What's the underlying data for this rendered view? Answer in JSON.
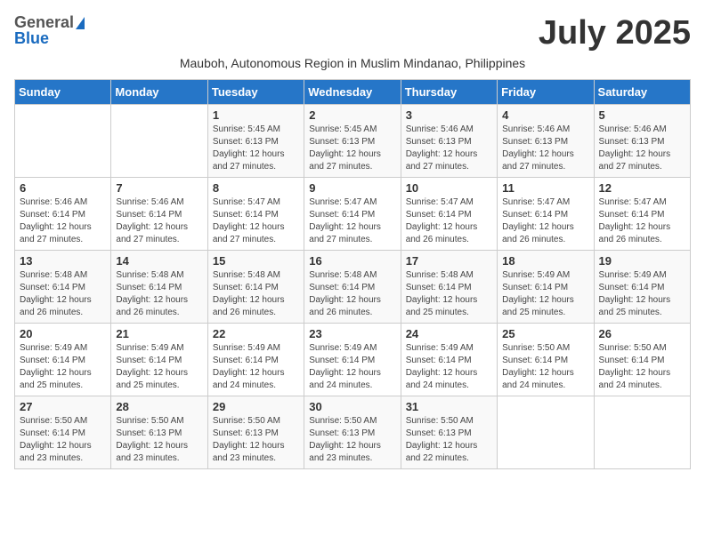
{
  "logo": {
    "general": "General",
    "blue": "Blue"
  },
  "title": "July 2025",
  "subtitle": "Mauboh, Autonomous Region in Muslim Mindanao, Philippines",
  "days_of_week": [
    "Sunday",
    "Monday",
    "Tuesday",
    "Wednesday",
    "Thursday",
    "Friday",
    "Saturday"
  ],
  "weeks": [
    [
      {
        "day": "",
        "sunrise": "",
        "sunset": "",
        "daylight": ""
      },
      {
        "day": "",
        "sunrise": "",
        "sunset": "",
        "daylight": ""
      },
      {
        "day": "1",
        "sunrise": "Sunrise: 5:45 AM",
        "sunset": "Sunset: 6:13 PM",
        "daylight": "Daylight: 12 hours and 27 minutes."
      },
      {
        "day": "2",
        "sunrise": "Sunrise: 5:45 AM",
        "sunset": "Sunset: 6:13 PM",
        "daylight": "Daylight: 12 hours and 27 minutes."
      },
      {
        "day": "3",
        "sunrise": "Sunrise: 5:46 AM",
        "sunset": "Sunset: 6:13 PM",
        "daylight": "Daylight: 12 hours and 27 minutes."
      },
      {
        "day": "4",
        "sunrise": "Sunrise: 5:46 AM",
        "sunset": "Sunset: 6:13 PM",
        "daylight": "Daylight: 12 hours and 27 minutes."
      },
      {
        "day": "5",
        "sunrise": "Sunrise: 5:46 AM",
        "sunset": "Sunset: 6:13 PM",
        "daylight": "Daylight: 12 hours and 27 minutes."
      }
    ],
    [
      {
        "day": "6",
        "sunrise": "Sunrise: 5:46 AM",
        "sunset": "Sunset: 6:14 PM",
        "daylight": "Daylight: 12 hours and 27 minutes."
      },
      {
        "day": "7",
        "sunrise": "Sunrise: 5:46 AM",
        "sunset": "Sunset: 6:14 PM",
        "daylight": "Daylight: 12 hours and 27 minutes."
      },
      {
        "day": "8",
        "sunrise": "Sunrise: 5:47 AM",
        "sunset": "Sunset: 6:14 PM",
        "daylight": "Daylight: 12 hours and 27 minutes."
      },
      {
        "day": "9",
        "sunrise": "Sunrise: 5:47 AM",
        "sunset": "Sunset: 6:14 PM",
        "daylight": "Daylight: 12 hours and 27 minutes."
      },
      {
        "day": "10",
        "sunrise": "Sunrise: 5:47 AM",
        "sunset": "Sunset: 6:14 PM",
        "daylight": "Daylight: 12 hours and 26 minutes."
      },
      {
        "day": "11",
        "sunrise": "Sunrise: 5:47 AM",
        "sunset": "Sunset: 6:14 PM",
        "daylight": "Daylight: 12 hours and 26 minutes."
      },
      {
        "day": "12",
        "sunrise": "Sunrise: 5:47 AM",
        "sunset": "Sunset: 6:14 PM",
        "daylight": "Daylight: 12 hours and 26 minutes."
      }
    ],
    [
      {
        "day": "13",
        "sunrise": "Sunrise: 5:48 AM",
        "sunset": "Sunset: 6:14 PM",
        "daylight": "Daylight: 12 hours and 26 minutes."
      },
      {
        "day": "14",
        "sunrise": "Sunrise: 5:48 AM",
        "sunset": "Sunset: 6:14 PM",
        "daylight": "Daylight: 12 hours and 26 minutes."
      },
      {
        "day": "15",
        "sunrise": "Sunrise: 5:48 AM",
        "sunset": "Sunset: 6:14 PM",
        "daylight": "Daylight: 12 hours and 26 minutes."
      },
      {
        "day": "16",
        "sunrise": "Sunrise: 5:48 AM",
        "sunset": "Sunset: 6:14 PM",
        "daylight": "Daylight: 12 hours and 26 minutes."
      },
      {
        "day": "17",
        "sunrise": "Sunrise: 5:48 AM",
        "sunset": "Sunset: 6:14 PM",
        "daylight": "Daylight: 12 hours and 25 minutes."
      },
      {
        "day": "18",
        "sunrise": "Sunrise: 5:49 AM",
        "sunset": "Sunset: 6:14 PM",
        "daylight": "Daylight: 12 hours and 25 minutes."
      },
      {
        "day": "19",
        "sunrise": "Sunrise: 5:49 AM",
        "sunset": "Sunset: 6:14 PM",
        "daylight": "Daylight: 12 hours and 25 minutes."
      }
    ],
    [
      {
        "day": "20",
        "sunrise": "Sunrise: 5:49 AM",
        "sunset": "Sunset: 6:14 PM",
        "daylight": "Daylight: 12 hours and 25 minutes."
      },
      {
        "day": "21",
        "sunrise": "Sunrise: 5:49 AM",
        "sunset": "Sunset: 6:14 PM",
        "daylight": "Daylight: 12 hours and 25 minutes."
      },
      {
        "day": "22",
        "sunrise": "Sunrise: 5:49 AM",
        "sunset": "Sunset: 6:14 PM",
        "daylight": "Daylight: 12 hours and 24 minutes."
      },
      {
        "day": "23",
        "sunrise": "Sunrise: 5:49 AM",
        "sunset": "Sunset: 6:14 PM",
        "daylight": "Daylight: 12 hours and 24 minutes."
      },
      {
        "day": "24",
        "sunrise": "Sunrise: 5:49 AM",
        "sunset": "Sunset: 6:14 PM",
        "daylight": "Daylight: 12 hours and 24 minutes."
      },
      {
        "day": "25",
        "sunrise": "Sunrise: 5:50 AM",
        "sunset": "Sunset: 6:14 PM",
        "daylight": "Daylight: 12 hours and 24 minutes."
      },
      {
        "day": "26",
        "sunrise": "Sunrise: 5:50 AM",
        "sunset": "Sunset: 6:14 PM",
        "daylight": "Daylight: 12 hours and 24 minutes."
      }
    ],
    [
      {
        "day": "27",
        "sunrise": "Sunrise: 5:50 AM",
        "sunset": "Sunset: 6:14 PM",
        "daylight": "Daylight: 12 hours and 23 minutes."
      },
      {
        "day": "28",
        "sunrise": "Sunrise: 5:50 AM",
        "sunset": "Sunset: 6:13 PM",
        "daylight": "Daylight: 12 hours and 23 minutes."
      },
      {
        "day": "29",
        "sunrise": "Sunrise: 5:50 AM",
        "sunset": "Sunset: 6:13 PM",
        "daylight": "Daylight: 12 hours and 23 minutes."
      },
      {
        "day": "30",
        "sunrise": "Sunrise: 5:50 AM",
        "sunset": "Sunset: 6:13 PM",
        "daylight": "Daylight: 12 hours and 23 minutes."
      },
      {
        "day": "31",
        "sunrise": "Sunrise: 5:50 AM",
        "sunset": "Sunset: 6:13 PM",
        "daylight": "Daylight: 12 hours and 22 minutes."
      },
      {
        "day": "",
        "sunrise": "",
        "sunset": "",
        "daylight": ""
      },
      {
        "day": "",
        "sunrise": "",
        "sunset": "",
        "daylight": ""
      }
    ]
  ]
}
